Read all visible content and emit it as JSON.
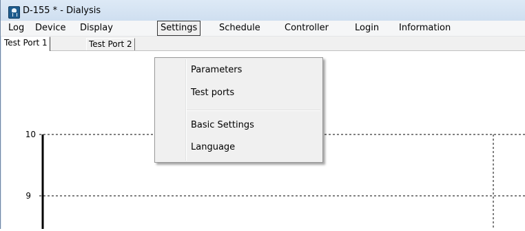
{
  "window": {
    "title": "D-155 * - Dialysis",
    "icon": "lightbulb-app-icon"
  },
  "menubar": {
    "items": [
      "Log",
      "Device",
      "Display",
      "Settings",
      "Schedule",
      "Controller",
      "Login",
      "Information"
    ],
    "active": "Settings"
  },
  "tabs": [
    "Test Port 1",
    "Test Port 2"
  ],
  "settings_menu": {
    "items": [
      "Parameters",
      "Test ports",
      "Basic Settings",
      "Language"
    ]
  },
  "chart_data": {
    "type": "line",
    "y_ticks": [
      "10",
      "9"
    ],
    "grid": "dashed",
    "series": []
  }
}
